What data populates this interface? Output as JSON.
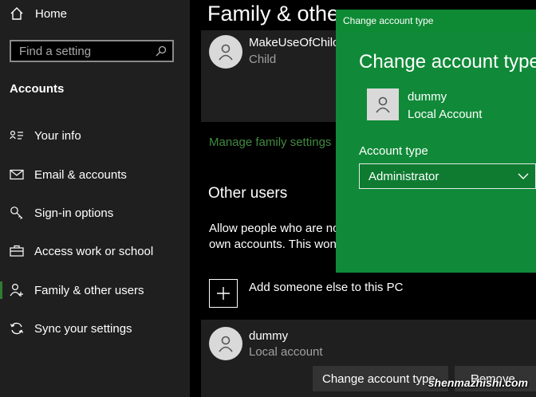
{
  "sidebar": {
    "home_label": "Home",
    "search_placeholder": "Find a setting",
    "section_title": "Accounts",
    "items": [
      {
        "label": "Your info",
        "icon": "person-card-icon"
      },
      {
        "label": "Email & accounts",
        "icon": "envelope-icon"
      },
      {
        "label": "Sign-in options",
        "icon": "key-icon"
      },
      {
        "label": "Access work or school",
        "icon": "briefcase-icon"
      },
      {
        "label": "Family & other users",
        "icon": "person-add-icon",
        "active": true
      },
      {
        "label": "Sync your settings",
        "icon": "sync-icon"
      }
    ]
  },
  "main": {
    "title": "Family & othe",
    "family_member": {
      "name": "MakeUseOfChilc",
      "role": "Child"
    },
    "manage_link": "Manage family settings",
    "other_users_title": "Other users",
    "desc_line1": "Allow people who are no",
    "desc_line2": "own accounts. This won",
    "add_label": "Add someone else to this PC",
    "user": {
      "name": "dummy",
      "type": "Local account"
    },
    "change_button": "Change account type",
    "remove_button": "Remove"
  },
  "dialog": {
    "window_title": "Change account type",
    "heading": "Change account type",
    "user_name": "dummy",
    "user_type": "Local Account",
    "field_label": "Account type",
    "selected_value": "Administrator"
  },
  "watermark": "shenmazhishi.com",
  "colors": {
    "accent_green": "#108a38",
    "link_green": "#3f8a3f",
    "sidebar_bg": "#1f1f1f"
  }
}
